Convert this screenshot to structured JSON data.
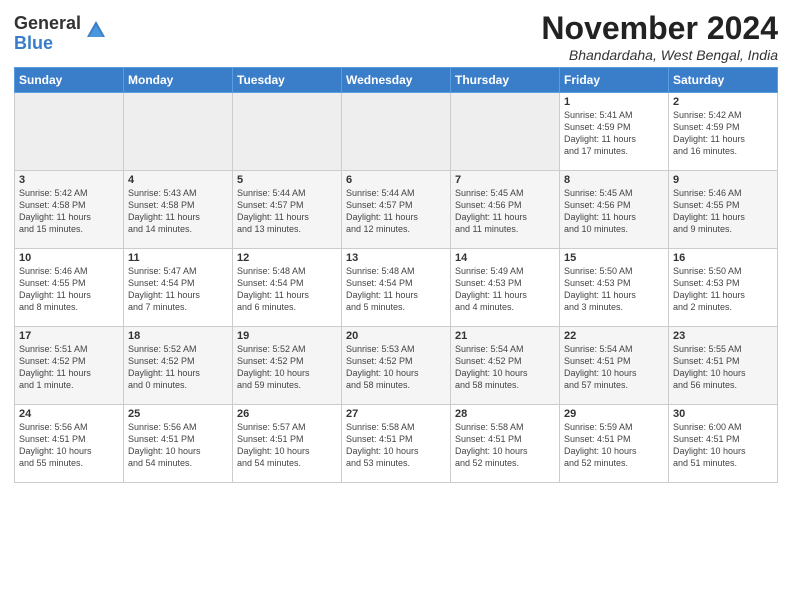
{
  "header": {
    "logo_line1": "General",
    "logo_line2": "Blue",
    "month_title": "November 2024",
    "subtitle": "Bhandardaha, West Bengal, India"
  },
  "weekdays": [
    "Sunday",
    "Monday",
    "Tuesday",
    "Wednesday",
    "Thursday",
    "Friday",
    "Saturday"
  ],
  "weeks": [
    [
      {
        "day": "",
        "info": ""
      },
      {
        "day": "",
        "info": ""
      },
      {
        "day": "",
        "info": ""
      },
      {
        "day": "",
        "info": ""
      },
      {
        "day": "",
        "info": ""
      },
      {
        "day": "1",
        "info": "Sunrise: 5:41 AM\nSunset: 4:59 PM\nDaylight: 11 hours\nand 17 minutes."
      },
      {
        "day": "2",
        "info": "Sunrise: 5:42 AM\nSunset: 4:59 PM\nDaylight: 11 hours\nand 16 minutes."
      }
    ],
    [
      {
        "day": "3",
        "info": "Sunrise: 5:42 AM\nSunset: 4:58 PM\nDaylight: 11 hours\nand 15 minutes."
      },
      {
        "day": "4",
        "info": "Sunrise: 5:43 AM\nSunset: 4:58 PM\nDaylight: 11 hours\nand 14 minutes."
      },
      {
        "day": "5",
        "info": "Sunrise: 5:44 AM\nSunset: 4:57 PM\nDaylight: 11 hours\nand 13 minutes."
      },
      {
        "day": "6",
        "info": "Sunrise: 5:44 AM\nSunset: 4:57 PM\nDaylight: 11 hours\nand 12 minutes."
      },
      {
        "day": "7",
        "info": "Sunrise: 5:45 AM\nSunset: 4:56 PM\nDaylight: 11 hours\nand 11 minutes."
      },
      {
        "day": "8",
        "info": "Sunrise: 5:45 AM\nSunset: 4:56 PM\nDaylight: 11 hours\nand 10 minutes."
      },
      {
        "day": "9",
        "info": "Sunrise: 5:46 AM\nSunset: 4:55 PM\nDaylight: 11 hours\nand 9 minutes."
      }
    ],
    [
      {
        "day": "10",
        "info": "Sunrise: 5:46 AM\nSunset: 4:55 PM\nDaylight: 11 hours\nand 8 minutes."
      },
      {
        "day": "11",
        "info": "Sunrise: 5:47 AM\nSunset: 4:54 PM\nDaylight: 11 hours\nand 7 minutes."
      },
      {
        "day": "12",
        "info": "Sunrise: 5:48 AM\nSunset: 4:54 PM\nDaylight: 11 hours\nand 6 minutes."
      },
      {
        "day": "13",
        "info": "Sunrise: 5:48 AM\nSunset: 4:54 PM\nDaylight: 11 hours\nand 5 minutes."
      },
      {
        "day": "14",
        "info": "Sunrise: 5:49 AM\nSunset: 4:53 PM\nDaylight: 11 hours\nand 4 minutes."
      },
      {
        "day": "15",
        "info": "Sunrise: 5:50 AM\nSunset: 4:53 PM\nDaylight: 11 hours\nand 3 minutes."
      },
      {
        "day": "16",
        "info": "Sunrise: 5:50 AM\nSunset: 4:53 PM\nDaylight: 11 hours\nand 2 minutes."
      }
    ],
    [
      {
        "day": "17",
        "info": "Sunrise: 5:51 AM\nSunset: 4:52 PM\nDaylight: 11 hours\nand 1 minute."
      },
      {
        "day": "18",
        "info": "Sunrise: 5:52 AM\nSunset: 4:52 PM\nDaylight: 11 hours\nand 0 minutes."
      },
      {
        "day": "19",
        "info": "Sunrise: 5:52 AM\nSunset: 4:52 PM\nDaylight: 10 hours\nand 59 minutes."
      },
      {
        "day": "20",
        "info": "Sunrise: 5:53 AM\nSunset: 4:52 PM\nDaylight: 10 hours\nand 58 minutes."
      },
      {
        "day": "21",
        "info": "Sunrise: 5:54 AM\nSunset: 4:52 PM\nDaylight: 10 hours\nand 58 minutes."
      },
      {
        "day": "22",
        "info": "Sunrise: 5:54 AM\nSunset: 4:51 PM\nDaylight: 10 hours\nand 57 minutes."
      },
      {
        "day": "23",
        "info": "Sunrise: 5:55 AM\nSunset: 4:51 PM\nDaylight: 10 hours\nand 56 minutes."
      }
    ],
    [
      {
        "day": "24",
        "info": "Sunrise: 5:56 AM\nSunset: 4:51 PM\nDaylight: 10 hours\nand 55 minutes."
      },
      {
        "day": "25",
        "info": "Sunrise: 5:56 AM\nSunset: 4:51 PM\nDaylight: 10 hours\nand 54 minutes."
      },
      {
        "day": "26",
        "info": "Sunrise: 5:57 AM\nSunset: 4:51 PM\nDaylight: 10 hours\nand 54 minutes."
      },
      {
        "day": "27",
        "info": "Sunrise: 5:58 AM\nSunset: 4:51 PM\nDaylight: 10 hours\nand 53 minutes."
      },
      {
        "day": "28",
        "info": "Sunrise: 5:58 AM\nSunset: 4:51 PM\nDaylight: 10 hours\nand 52 minutes."
      },
      {
        "day": "29",
        "info": "Sunrise: 5:59 AM\nSunset: 4:51 PM\nDaylight: 10 hours\nand 52 minutes."
      },
      {
        "day": "30",
        "info": "Sunrise: 6:00 AM\nSunset: 4:51 PM\nDaylight: 10 hours\nand 51 minutes."
      }
    ]
  ]
}
